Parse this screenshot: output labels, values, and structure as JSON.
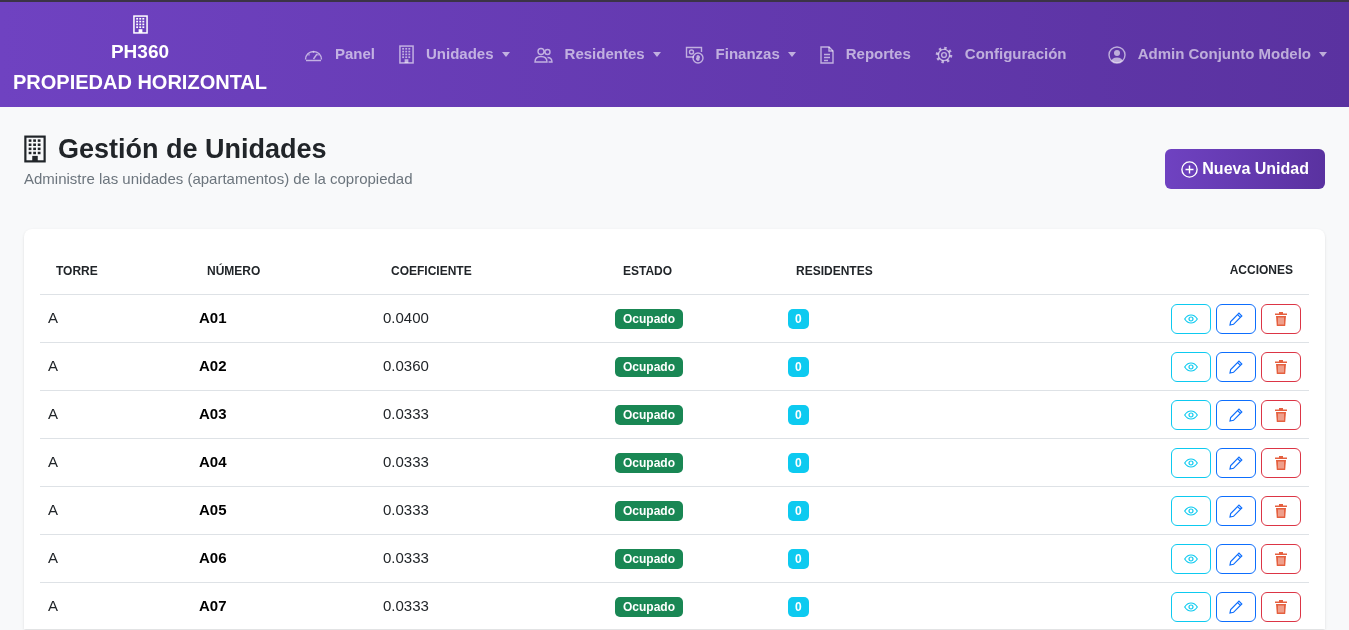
{
  "navbar": {
    "brand": {
      "name": "PH360",
      "subtitle": "PROPIEDAD HORIZONTAL"
    },
    "items": [
      {
        "label": "Panel",
        "dropdown": false
      },
      {
        "label": "Unidades",
        "dropdown": true
      },
      {
        "label": "Residentes",
        "dropdown": true
      },
      {
        "label": "Finanzas",
        "dropdown": true
      },
      {
        "label": "Reportes",
        "dropdown": false
      },
      {
        "label": "Configuración",
        "dropdown": false
      }
    ],
    "user": {
      "label": "Admin Conjunto Modelo",
      "dropdown": true
    }
  },
  "page": {
    "title": "Gestión de Unidades",
    "subtitle": "Administre las unidades (apartamentos) de la copropiedad",
    "new_button": "Nueva Unidad"
  },
  "table": {
    "columns": [
      "TORRE",
      "NÚMERO",
      "COEFICIENTE",
      "ESTADO",
      "RESIDENTES",
      "ACCIONES"
    ],
    "rows": [
      {
        "torre": "A",
        "numero": "A01",
        "coeficiente": "0.0400",
        "estado": "Ocupado",
        "residentes": "0"
      },
      {
        "torre": "A",
        "numero": "A02",
        "coeficiente": "0.0360",
        "estado": "Ocupado",
        "residentes": "0"
      },
      {
        "torre": "A",
        "numero": "A03",
        "coeficiente": "0.0333",
        "estado": "Ocupado",
        "residentes": "0"
      },
      {
        "torre": "A",
        "numero": "A04",
        "coeficiente": "0.0333",
        "estado": "Ocupado",
        "residentes": "0"
      },
      {
        "torre": "A",
        "numero": "A05",
        "coeficiente": "0.0333",
        "estado": "Ocupado",
        "residentes": "0"
      },
      {
        "torre": "A",
        "numero": "A06",
        "coeficiente": "0.0333",
        "estado": "Ocupado",
        "residentes": "0"
      },
      {
        "torre": "A",
        "numero": "A07",
        "coeficiente": "0.0333",
        "estado": "Ocupado",
        "residentes": "0"
      }
    ]
  }
}
